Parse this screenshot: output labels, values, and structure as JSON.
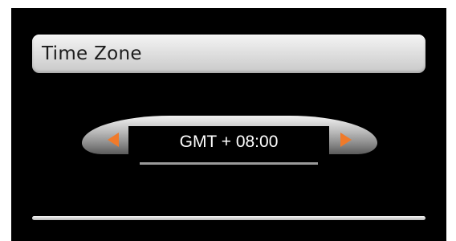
{
  "header": {
    "title": "Time Zone"
  },
  "time_zone_selector": {
    "value": "GMT + 08:00",
    "prev_icon": "triangle-left-icon",
    "next_icon": "triangle-right-icon"
  },
  "colors": {
    "background": "#000000",
    "title_bar": "#dcdcdc",
    "arrow_accent": "#f07a2a",
    "value_text": "#ffffff"
  }
}
